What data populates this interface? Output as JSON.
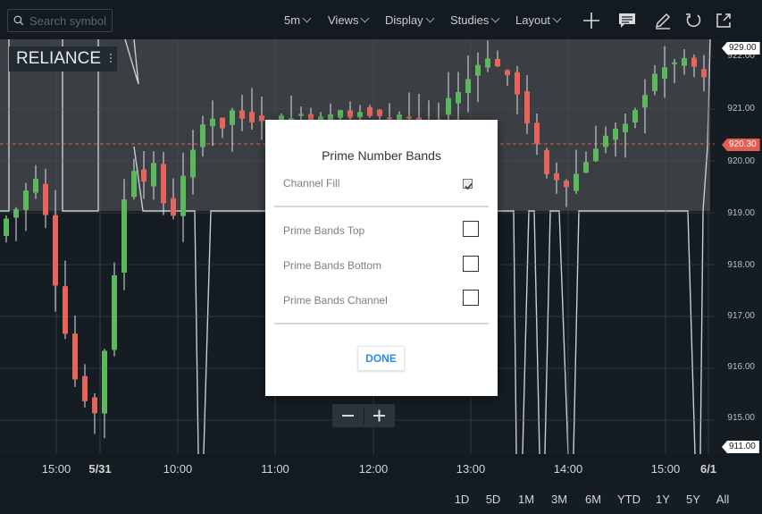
{
  "search": {
    "placeholder": "Search symbol"
  },
  "toolbar": {
    "interval": "5m",
    "views": "Views",
    "display": "Display",
    "studies": "Studies",
    "layout": "Layout"
  },
  "symbol": "RELIANCE",
  "y_axis": {
    "labels": [
      "922.00",
      "921.00",
      "920.00",
      "919.00",
      "918.00",
      "917.00",
      "916.00",
      "915.00"
    ],
    "top_value": "929.00",
    "current_price": "920.30",
    "bottom_value": "911.00",
    "current_price_color": "#e55d52"
  },
  "x_axis": {
    "labels": [
      "15:00",
      "5/31",
      "10:00",
      "11:00",
      "12:00",
      "13:00",
      "14:00",
      "15:00",
      "6/1"
    ]
  },
  "ranges": [
    "1D",
    "5D",
    "1M",
    "3M",
    "6M",
    "YTD",
    "1Y",
    "5Y",
    "All"
  ],
  "dialog": {
    "title": "Prime Number Bands",
    "channel_fill_label": "Channel Fill",
    "channel_fill_checked": true,
    "options": [
      "Prime Bands Top",
      "Prime Bands Bottom",
      "Prime Bands Channel"
    ],
    "done_label": "DONE"
  },
  "zoom": {
    "minus": "−",
    "plus": "+"
  },
  "colors": {
    "up": "#5cb85c",
    "down": "#e6645a",
    "background": "#151c22",
    "band_fill": "#3b3f44"
  }
}
